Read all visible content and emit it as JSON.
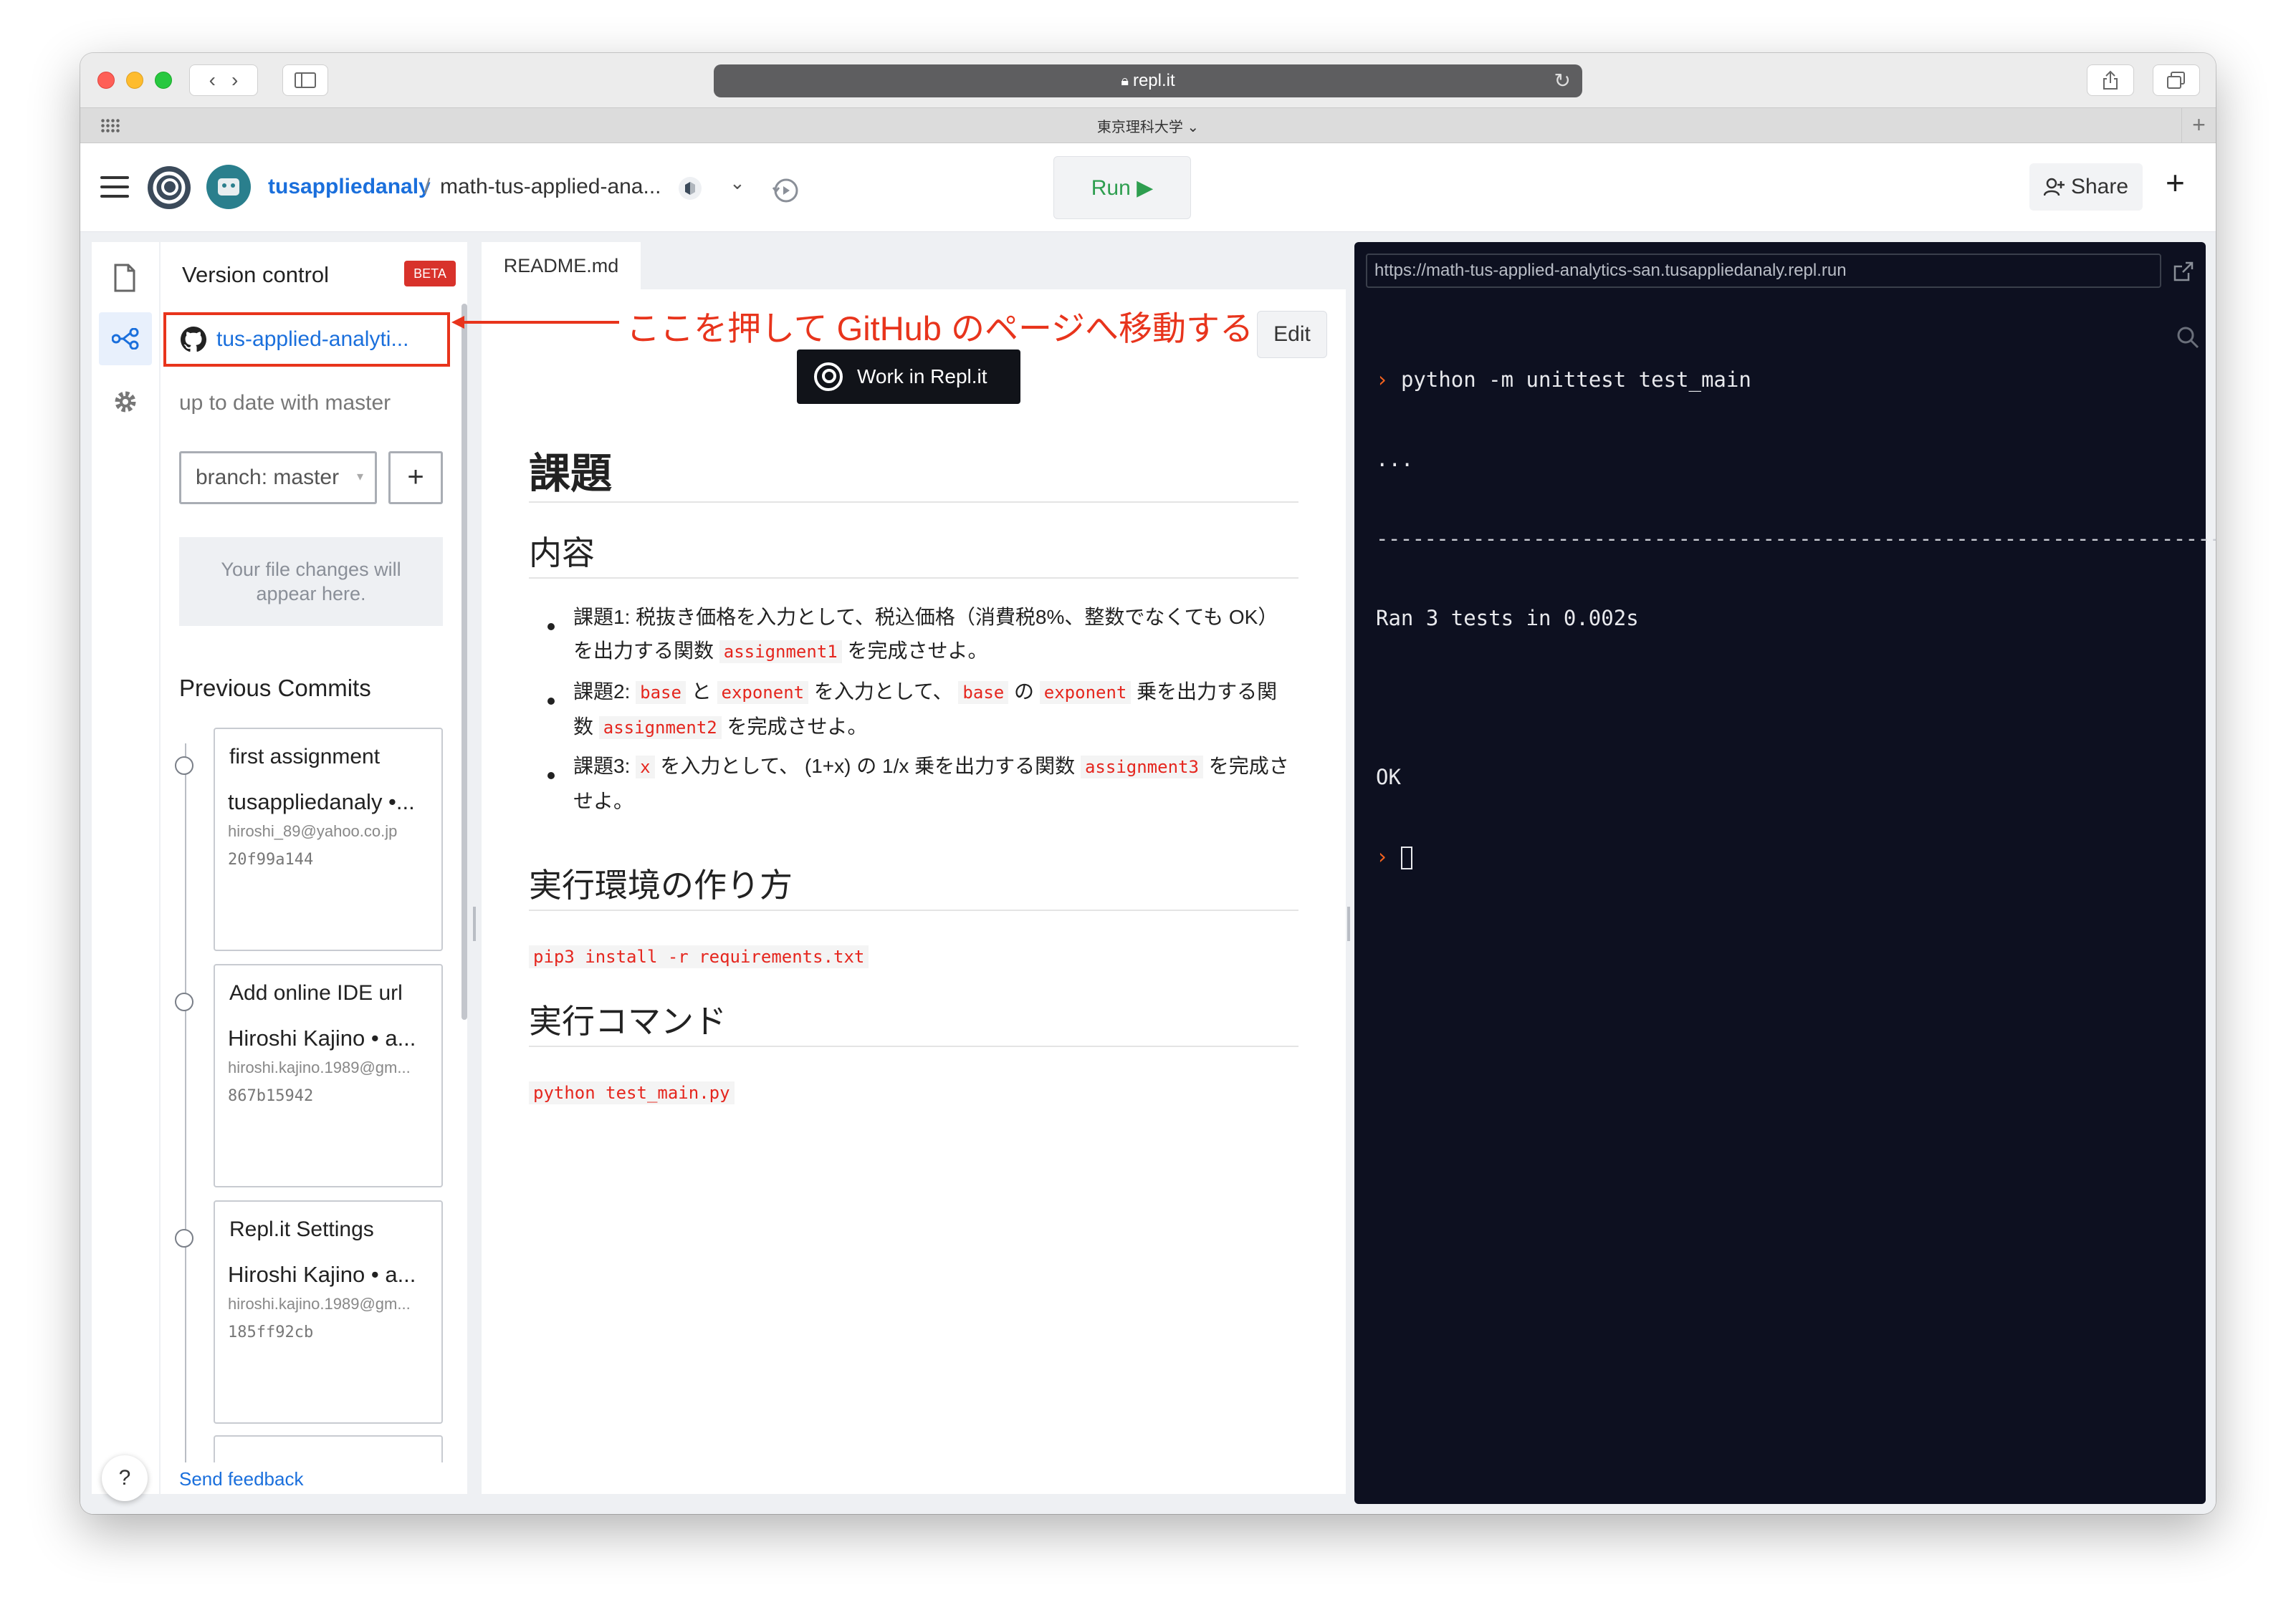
{
  "browser": {
    "url": "repl.it",
    "tab_group": "東京理科大学 ⌄"
  },
  "header": {
    "owner": "tusappliedanaly",
    "separator": "/",
    "repl_name": "math-tus-applied-ana...",
    "run_label": "Run ▶",
    "share_label": "Share",
    "plus": "+"
  },
  "sidebar": {
    "title": "Version control",
    "beta": "BETA",
    "repo_link": "tus-applied-analyti...",
    "status": "up to date with master",
    "branch": "branch: master",
    "add": "+",
    "empty_changes": "Your file changes will appear here.",
    "previous_commits": "Previous Commits",
    "commits": [
      {
        "title": "first assignment",
        "author": "tusappliedanaly •...",
        "email": "hiroshi_89@yahoo.co.jp",
        "hash": "20f99a144"
      },
      {
        "title": "Add online IDE url",
        "author": "Hiroshi Kajino • a...",
        "email": "hiroshi.kajino.1989@gm...",
        "hash": "867b15942"
      },
      {
        "title": "Repl.it Settings",
        "author": "Hiroshi Kajino • a...",
        "email": "hiroshi.kajino.1989@gm...",
        "hash": "185ff92cb"
      }
    ],
    "help": "?",
    "send_feedback": "Send feedback"
  },
  "annotation": {
    "text": "ここを押して GitHub のページへ移動する",
    "color": "#e8341c"
  },
  "editor": {
    "tab": "README.md",
    "edit_label": "Edit",
    "work_label": "Work in Repl.it",
    "h1": "課題",
    "h2_contents": "内容",
    "items": [
      {
        "parts": [
          "課題1: 税抜き価格を入力として、税込価格（消費税8%、整数でなくても OK）を出力する関数 ",
          "assignment1",
          " を完成させよ。"
        ]
      },
      {
        "parts": [
          "課題2: ",
          "base",
          " と ",
          "exponent",
          " を入力として、 ",
          "base",
          " の ",
          "exponent",
          " 乗を出力する関数 ",
          "assignment2",
          " を完成させよ。"
        ]
      },
      {
        "parts": [
          "課題3: ",
          "x",
          " を入力として、 (1+x) の 1/x 乗を出力する関数 ",
          "assignment3",
          " を完成させよ。"
        ]
      }
    ],
    "h2_env": "実行環境の作り方",
    "code_env": "pip3 install -r requirements.txt",
    "h2_cmd": "実行コマンド",
    "code_cmd": "python test_main.py"
  },
  "console": {
    "url": "https://math-tus-applied-analytics-san.tusappliedanaly.repl.run",
    "command": "python -m unittest test_main",
    "dots": "...",
    "separator": "----------------------------------------------------------------------",
    "result": "Ran 3 tests in 0.002s",
    "ok": "OK"
  },
  "colors": {
    "accent_blue": "#1a6fdc",
    "run_green": "#2e9e4f",
    "console_bg": "#0d1020",
    "prompt_orange": "#f2621f",
    "beta_red": "#d8322b"
  }
}
